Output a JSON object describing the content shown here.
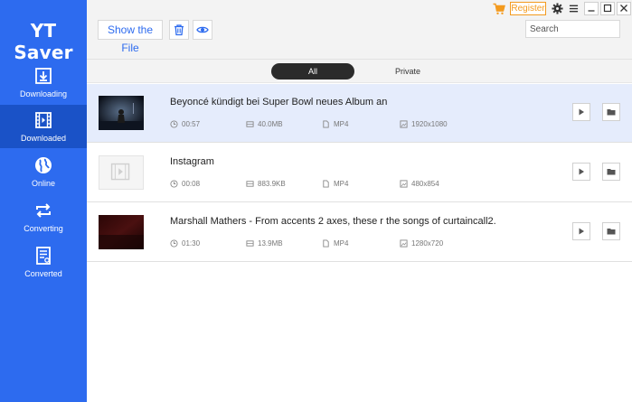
{
  "app": {
    "title": "YT Saver"
  },
  "sidebar": {
    "items": [
      {
        "label": "Downloading",
        "icon": "download-icon",
        "active": false
      },
      {
        "label": "Downloaded",
        "icon": "film-icon",
        "active": true
      },
      {
        "label": "Online",
        "icon": "globe-icon",
        "active": false
      },
      {
        "label": "Converting",
        "icon": "convert-icon",
        "active": false
      },
      {
        "label": "Converted",
        "icon": "document-icon",
        "active": false
      }
    ]
  },
  "toolbar": {
    "show_file_label": "Show the File",
    "search_placeholder": "Search"
  },
  "window": {
    "register_label": "Register"
  },
  "tabs": [
    {
      "label": "All",
      "active": true
    },
    {
      "label": "Private",
      "active": false
    }
  ],
  "colors": {
    "sidebar": "#2d6bef",
    "sidebar_active": "#1a52c7",
    "accent": "#2d6bef",
    "register": "#f39a1e",
    "selected_row": "#e5ecfc"
  },
  "videos": [
    {
      "title": "Beyoncé kündigt bei Super Bowl neues Album an",
      "duration": "00:57",
      "size": "40.0MB",
      "format": "MP4",
      "resolution": "1920x1080",
      "selected": true
    },
    {
      "title": "Instagram",
      "duration": "00:08",
      "size": "883.9KB",
      "format": "MP4",
      "resolution": "480x854",
      "selected": false
    },
    {
      "title": "Marshall Mathers - From accents 2 axes, these r the songs of curtaincall2.",
      "duration": "01:30",
      "size": "13.9MB",
      "format": "MP4",
      "resolution": "1280x720",
      "selected": false
    }
  ]
}
